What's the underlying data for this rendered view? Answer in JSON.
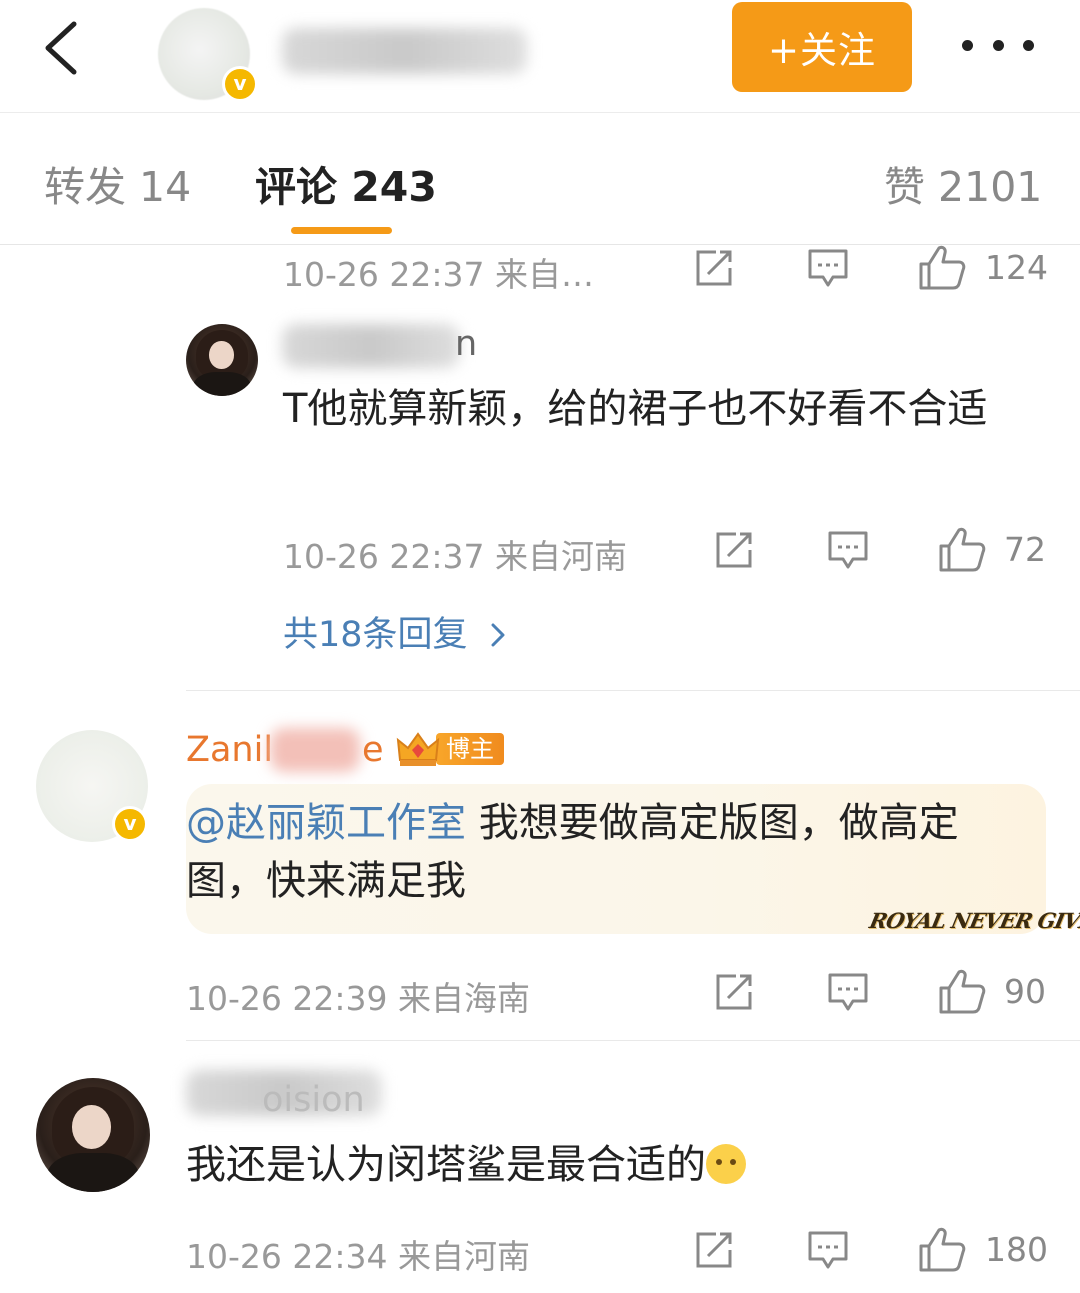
{
  "header": {
    "follow_label": "+关注"
  },
  "tabs": {
    "repost": "转发 14",
    "comments": "评论 243",
    "likes": "赞 2101"
  },
  "comments": [
    {
      "meta": "10-26 22:37  来自…",
      "likes": "124"
    },
    {
      "username_tail": "n",
      "text": "T他就算新颖，给的裙子也不好看不合适",
      "meta": "10-26 22:37  来自河南",
      "likes": "72",
      "replies_label": "共18条回复",
      "replies_icon": "chevron-right-icon"
    },
    {
      "username_head": "Zanil",
      "username_tail": "e",
      "badge": "博主",
      "mention": "@赵丽颖工作室",
      "text": " 我想要做高定版图，做高定图，快来满足我",
      "bubble_text": "ROYAL NEVER GIVE UP",
      "meta": "10-26 22:39  来自海南",
      "likes": "90"
    },
    {
      "username_tail": "oision",
      "text": "我还是认为闵塔鲨是最合适的",
      "emoji": "pleading-face-emoji",
      "meta": "10-26 22:34  来自河南",
      "likes": "180"
    }
  ],
  "colors": {
    "accent": "#f59a17",
    "link": "#4a7fb5",
    "verified": "#f5b800"
  }
}
